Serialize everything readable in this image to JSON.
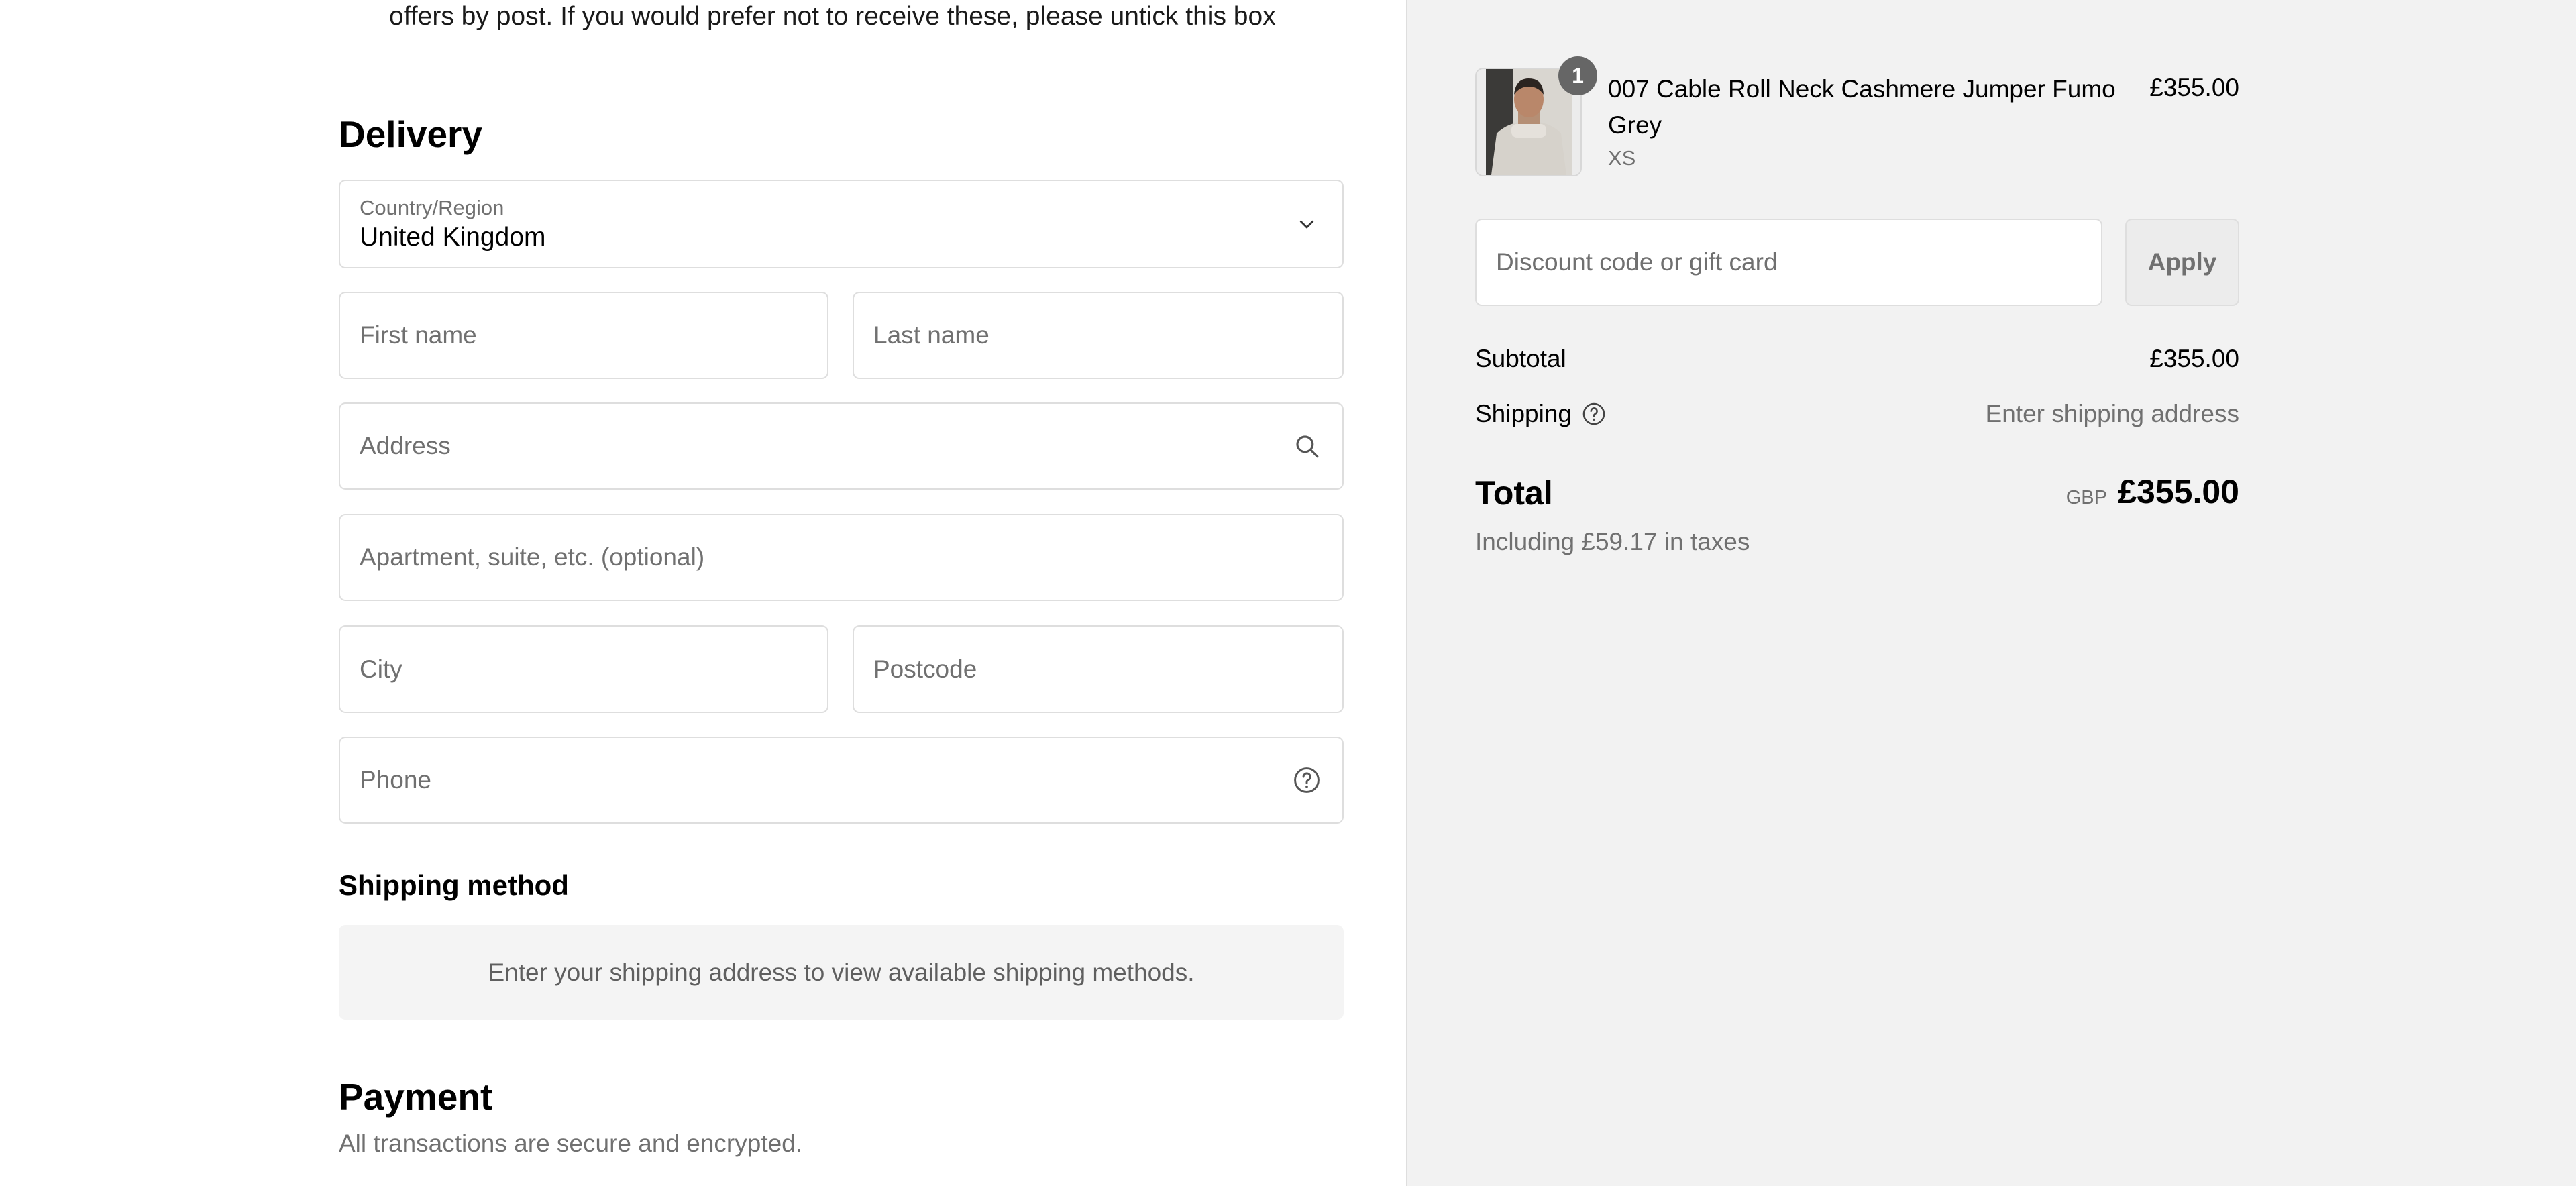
{
  "checkout": {
    "marketing_text": "offers by post. If you would prefer not to receive these, please untick this box",
    "delivery": {
      "heading": "Delivery",
      "country": {
        "label": "Country/Region",
        "value": "United Kingdom"
      },
      "first_name_placeholder": "First name",
      "last_name_placeholder": "Last name",
      "address_placeholder": "Address",
      "apartment_placeholder": "Apartment, suite, etc. (optional)",
      "city_placeholder": "City",
      "postcode_placeholder": "Postcode",
      "phone_placeholder": "Phone"
    },
    "shipping_method": {
      "heading": "Shipping method",
      "notice": "Enter your shipping address to view available shipping methods."
    },
    "payment": {
      "heading": "Payment",
      "subtitle": "All transactions are secure and encrypted."
    }
  },
  "summary": {
    "item": {
      "quantity": "1",
      "name": "007 Cable Roll Neck Cashmere Jumper Fumo Grey",
      "variant": "XS",
      "price": "£355.00"
    },
    "discount_placeholder": "Discount code or gift card",
    "apply_label": "Apply",
    "subtotal_label": "Subtotal",
    "subtotal_value": "£355.00",
    "shipping_label": "Shipping",
    "shipping_value": "Enter shipping address",
    "total_label": "Total",
    "total_currency": "GBP",
    "total_value": "£355.00",
    "tax_note": "Including £59.17 in taxes"
  },
  "icons": {
    "country_dropdown": "chevron-down-icon",
    "address": "search-icon",
    "phone": "help-circle-icon",
    "shipping_info": "help-circle-icon"
  },
  "colors": {
    "summary_background": "#f2f2f2",
    "border": "#dedede",
    "muted_text": "#707070",
    "badge": "#666666"
  }
}
